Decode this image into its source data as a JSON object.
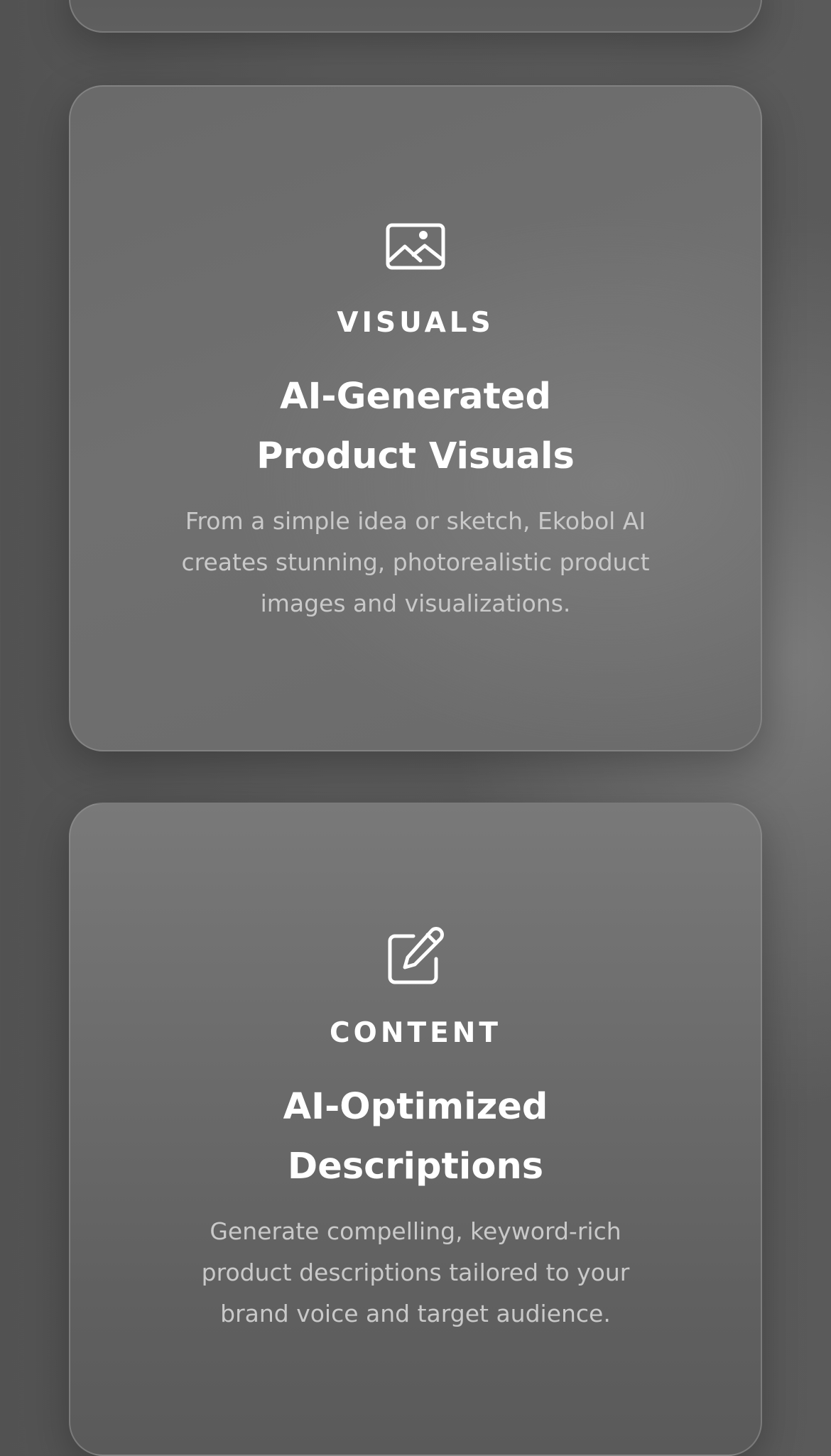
{
  "cards": [
    {
      "icon": "image-icon",
      "eyebrow": "VISUALS",
      "title": "AI-Generated Product Visuals",
      "description": "From a simple idea or sketch, Ekobol AI creates stunning, photorealistic product images and visualizations."
    },
    {
      "icon": "edit-icon",
      "eyebrow": "CONTENT",
      "title": "AI-Optimized Descriptions",
      "description": "Generate compelling, keyword-rich product descriptions tailored to your brand voice and target audience."
    }
  ],
  "colors": {
    "background": "#5a5a5a",
    "card": "#6e6e6e",
    "text": "#ffffff",
    "muted_text": "#c9c9c9"
  }
}
